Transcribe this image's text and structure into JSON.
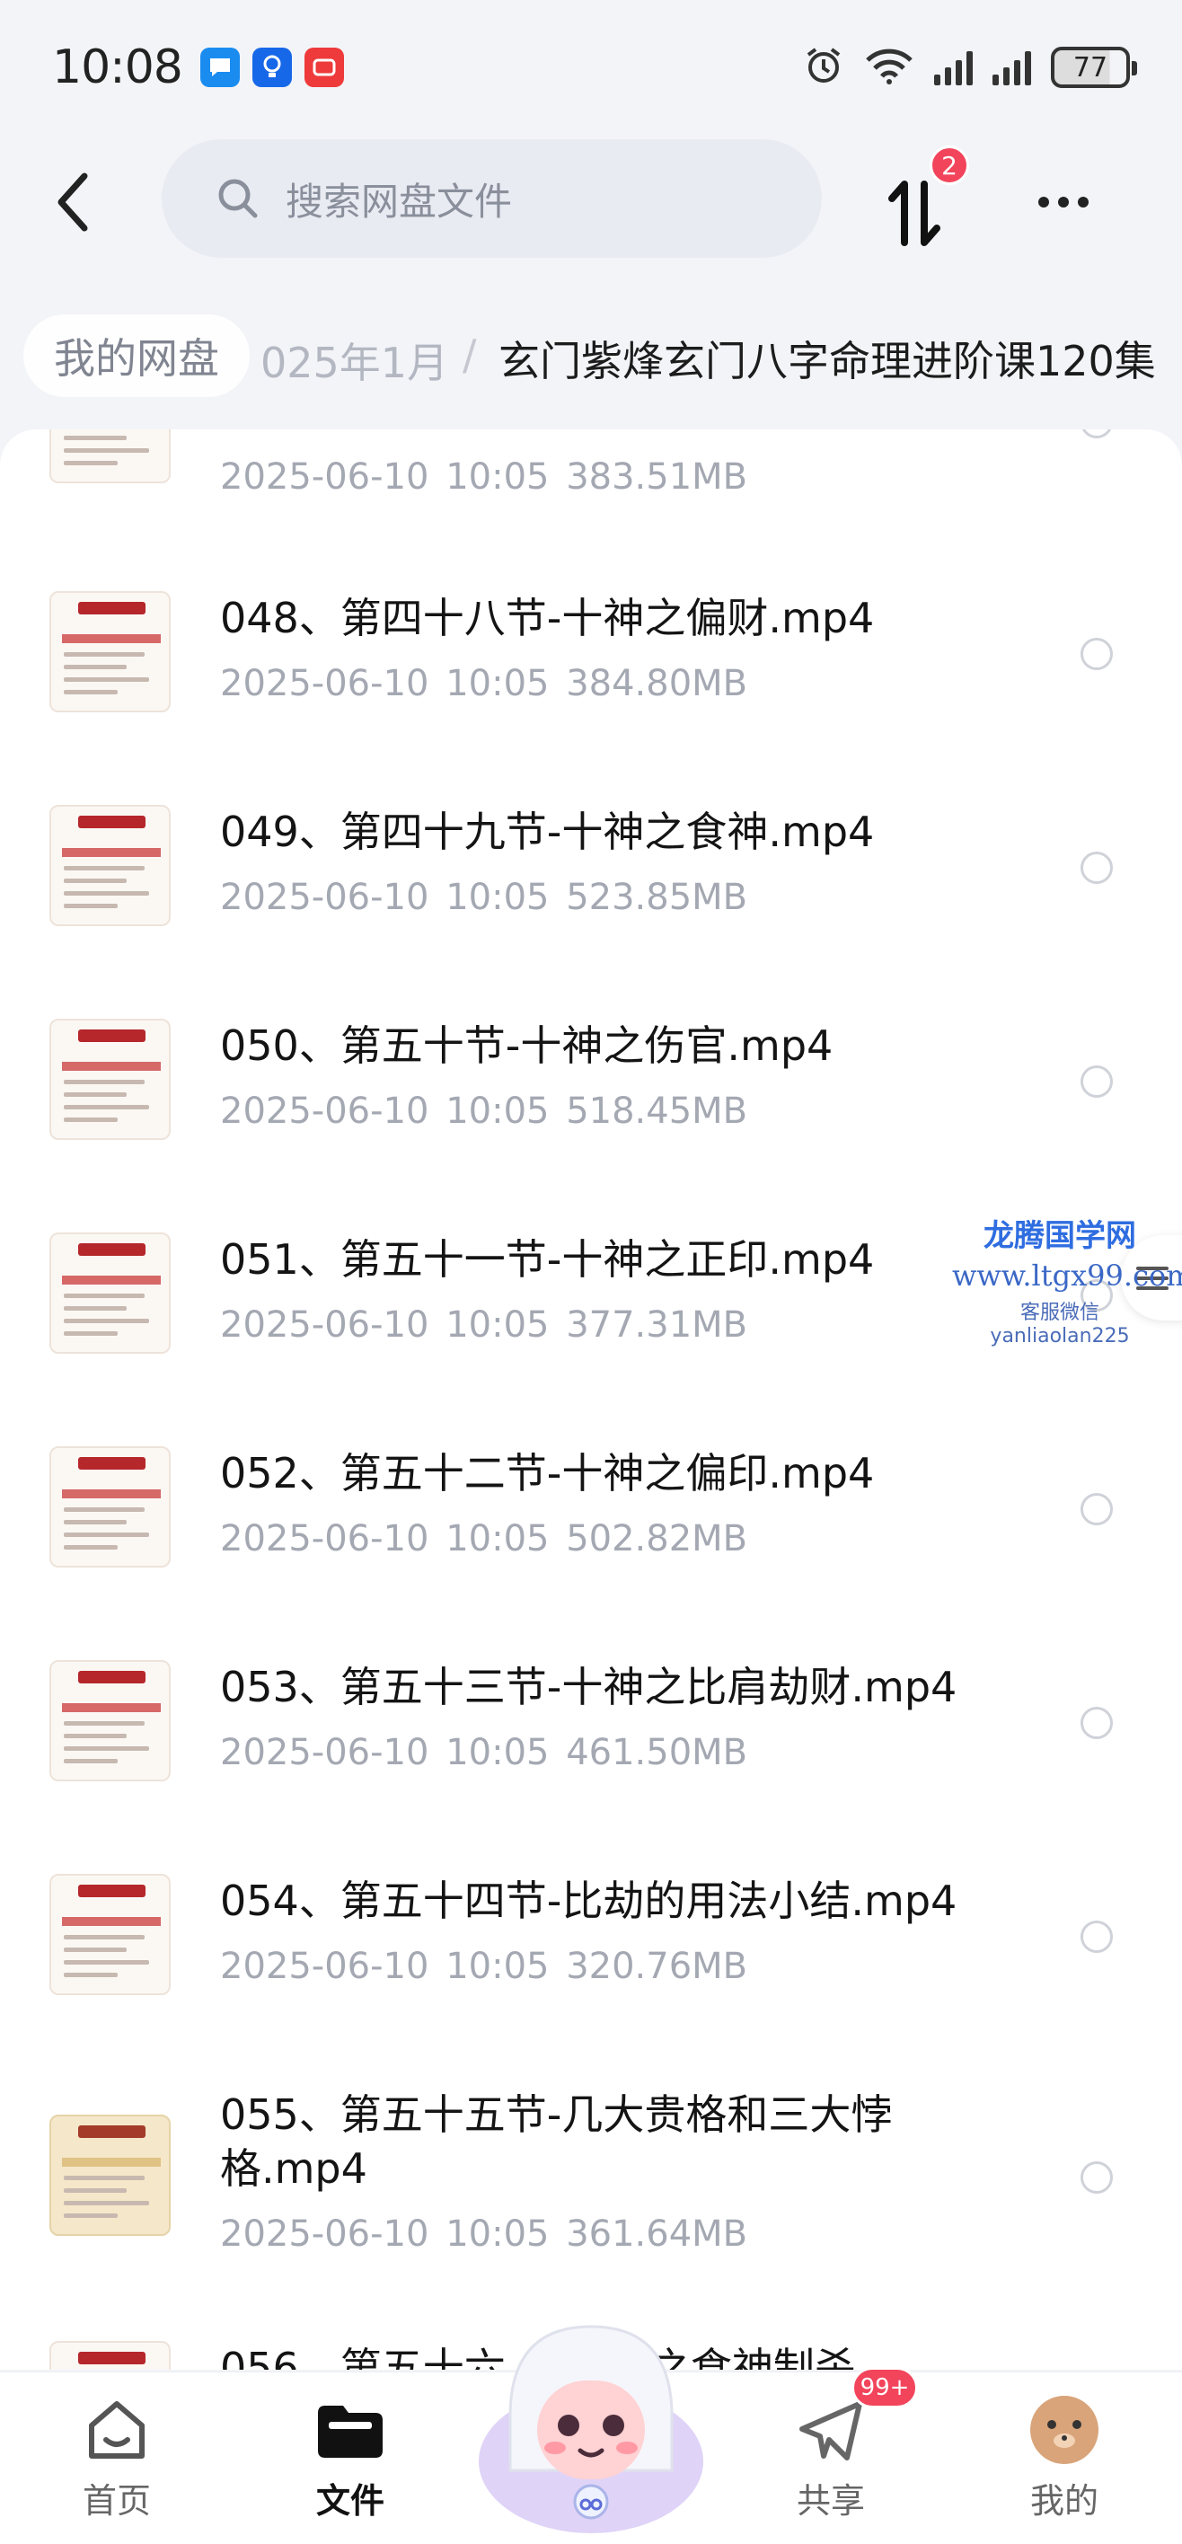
{
  "status_bar": {
    "time": "10:08",
    "battery": "77",
    "notification_icons": [
      "chat-bubble-icon",
      "bulb-icon",
      "video-app-icon"
    ],
    "notification_colors": [
      "#1a8cf0",
      "#1768e8",
      "#ee3a3a"
    ]
  },
  "header": {
    "search_placeholder": "搜索网盘文件",
    "transfer_badge": "2"
  },
  "breadcrumb": {
    "home": "我的网盘",
    "parent": "025年1月",
    "separator": "/",
    "current": "玄门紫烽玄门八字命理进阶课120集"
  },
  "files": [
    {
      "name": "",
      "date": "2025-06-10",
      "time": "10:05",
      "size": "383.51MB",
      "thumb": "red-table"
    },
    {
      "name": "048、第四十八节-十神之偏财.mp4",
      "date": "2025-06-10",
      "time": "10:05",
      "size": "384.80MB",
      "thumb": "red-table"
    },
    {
      "name": "049、第四十九节-十神之食神.mp4",
      "date": "2025-06-10",
      "time": "10:05",
      "size": "523.85MB",
      "thumb": "red-table"
    },
    {
      "name": "050、第五十节-十神之伤官.mp4",
      "date": "2025-06-10",
      "time": "10:05",
      "size": "518.45MB",
      "thumb": "red-table"
    },
    {
      "name": "051、第五十一节-十神之正印.mp4",
      "date": "2025-06-10",
      "time": "10:05",
      "size": "377.31MB",
      "thumb": "red-table"
    },
    {
      "name": "052、第五十二节-十神之偏印.mp4",
      "date": "2025-06-10",
      "time": "10:05",
      "size": "502.82MB",
      "thumb": "red-table"
    },
    {
      "name": "053、第五十三节-十神之比肩劫财.mp4",
      "date": "2025-06-10",
      "time": "10:05",
      "size": "461.50MB",
      "thumb": "red-table"
    },
    {
      "name": "054、第五十四节-比劫的用法小结.mp4",
      "date": "2025-06-10",
      "time": "10:05",
      "size": "320.76MB",
      "thumb": "red-table"
    },
    {
      "name": "055、第五十五节-几大贵格和三大悖格.mp4",
      "date": "2025-06-10",
      "time": "10:05",
      "size": "361.64MB",
      "thumb": "gold-table"
    },
    {
      "name": "056、第五十六",
      "date": "",
      "time": "",
      "size": "",
      "thumb": "red-table"
    }
  ],
  "last_partial_name_tail": "之食神制杀",
  "watermark": {
    "line1": "龙腾国学网",
    "line2": "www.ltgx99.com",
    "line3": "客服微信 yanliaolan225"
  },
  "bottom_nav": {
    "tabs": [
      {
        "label": "首页",
        "icon": "home-icon",
        "active": false
      },
      {
        "label": "文件",
        "icon": "folder-icon",
        "active": true
      },
      {
        "label": "共享",
        "icon": "share-plane-icon",
        "active": false,
        "badge": "99+"
      },
      {
        "label": "我的",
        "icon": "avatar-icon",
        "active": false
      }
    ]
  },
  "colors": {
    "accent_red": "#f2445b",
    "meta_gray": "#a4a8b2",
    "page_bg": "#f3f4f8"
  }
}
